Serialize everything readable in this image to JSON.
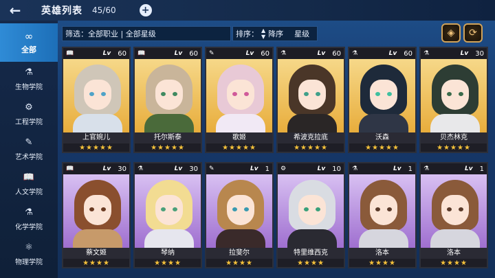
{
  "header": {
    "title": "英雄列表",
    "count": "45/60"
  },
  "sidebar": [
    {
      "label": "全部",
      "icon": "infinity-icon",
      "glyph": "∞",
      "active": true
    },
    {
      "label": "生物学院",
      "icon": "bio-icon",
      "glyph": "⚗",
      "active": false
    },
    {
      "label": "工程学院",
      "icon": "robot-icon",
      "glyph": "⚙",
      "active": false
    },
    {
      "label": "艺术学院",
      "icon": "brush-icon",
      "glyph": "✎",
      "active": false
    },
    {
      "label": "人文学院",
      "icon": "book-icon",
      "glyph": "📖",
      "active": false
    },
    {
      "label": "化学学院",
      "icon": "flask-icon",
      "glyph": "⚗",
      "active": false
    },
    {
      "label": "物理学院",
      "icon": "atom-icon",
      "glyph": "⚛",
      "active": false
    }
  ],
  "filter": {
    "text": "筛选：全部职业 | 全部星级"
  },
  "sort": {
    "label": "排序：",
    "order": "降序",
    "field": "星级"
  },
  "heroes": [
    {
      "name": "上官婉儿",
      "level": "60",
      "stars": "★★★★★",
      "rarity": "gold",
      "class_icon": "book-icon",
      "hair": "#cfc6b8",
      "eye": "#4fa3c7",
      "outfit": "#d8e0ea"
    },
    {
      "name": "托尔斯泰",
      "level": "60",
      "stars": "★★★★★",
      "rarity": "gold",
      "class_icon": "book-icon",
      "hair": "#c9b59a",
      "eye": "#3f8a60",
      "outfit": "#4a6a3a"
    },
    {
      "name": "歌姬",
      "level": "60",
      "stars": "★★★★★",
      "rarity": "gold",
      "class_icon": "brush-icon",
      "hair": "#e8c9d6",
      "eye": "#d05a9a",
      "outfit": "#f1e9f5"
    },
    {
      "name": "希波克拉底",
      "level": "60",
      "stars": "★★★★★",
      "rarity": "gold",
      "class_icon": "bio-icon",
      "hair": "#4a3628",
      "eye": "#3fa08a",
      "outfit": "#2a2626"
    },
    {
      "name": "沃森",
      "level": "60",
      "stars": "★★★★★",
      "rarity": "gold",
      "class_icon": "bio-icon",
      "hair": "#1e2a3a",
      "eye": "#3fc0a0",
      "outfit": "#2f3646"
    },
    {
      "name": "贝杰林克",
      "level": "30",
      "stars": "★★★★★",
      "rarity": "gold",
      "class_icon": "bio-icon",
      "hair": "#2d3d34",
      "eye": "#3a6a4a",
      "outfit": "#e8e8ea"
    },
    {
      "name": "蔡文姬",
      "level": "30",
      "stars": "★★★★",
      "rarity": "purple",
      "class_icon": "book-icon",
      "hair": "#8a4f2e",
      "eye": "#6a3a22",
      "outfit": "#c79a6a"
    },
    {
      "name": "琴纳",
      "level": "30",
      "stars": "★★★★",
      "rarity": "purple",
      "class_icon": "bio-icon",
      "hair": "#f2dc92",
      "eye": "#4aa07a",
      "outfit": "#e6e6ee"
    },
    {
      "name": "拉斐尔",
      "level": "1",
      "stars": "★★★★",
      "rarity": "purple",
      "class_icon": "brush-icon",
      "hair": "#b8874e",
      "eye": "#3a9ab0",
      "outfit": "#3a2a2a"
    },
    {
      "name": "特里维西克",
      "level": "10",
      "stars": "★★★★",
      "rarity": "purple",
      "class_icon": "robot-icon",
      "hair": "#d9dce2",
      "eye": "#3aa07a",
      "outfit": "#2a2a32"
    },
    {
      "name": "洛本",
      "level": "1",
      "stars": "★★★★",
      "rarity": "purple",
      "class_icon": "bio-icon",
      "hair": "#8a5a3a",
      "eye": "#5a3a2a",
      "outfit": "#d6d6de"
    },
    {
      "name": "洛本",
      "level": "1",
      "stars": "★★★★",
      "rarity": "purple",
      "class_icon": "bio-icon",
      "hair": "#8a5a3a",
      "eye": "#5a3a2a",
      "outfit": "#d6d6de"
    }
  ]
}
